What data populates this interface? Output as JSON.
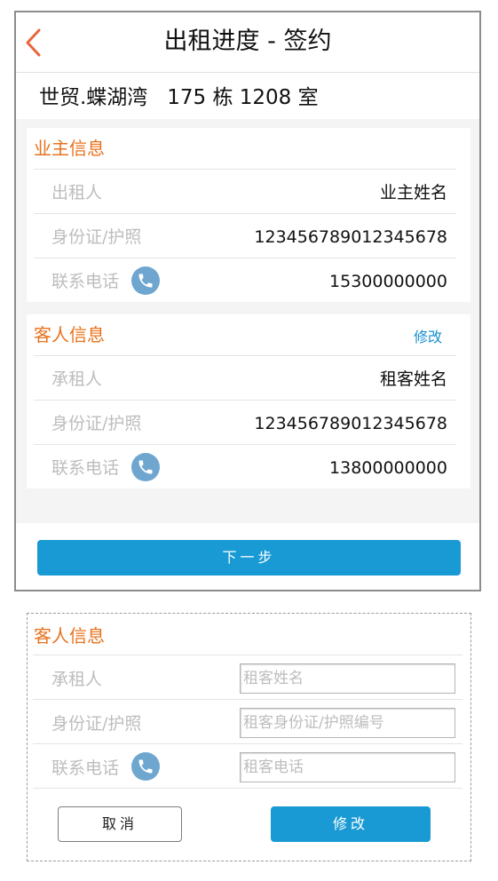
{
  "header": {
    "title": "出租进度 - 签约",
    "back_icon": "chevron-left-icon"
  },
  "property": {
    "address": "世贸.蝶湖湾   175 栋 1208 室"
  },
  "owner_section": {
    "title": "业主信息",
    "rows": [
      {
        "label": "出租人",
        "value": "业主姓名"
      },
      {
        "label": "身份证/护照",
        "value": "123456789012345678"
      },
      {
        "label": "联系电话",
        "value": "15300000000",
        "icon": "phone-icon"
      }
    ]
  },
  "guest_section": {
    "title": "客人信息",
    "edit_label": "修改",
    "rows": [
      {
        "label": "承租人",
        "value": "租客姓名"
      },
      {
        "label": "身份证/护照",
        "value": "123456789012345678"
      },
      {
        "label": "联系电话",
        "value": "13800000000",
        "icon": "phone-icon"
      }
    ]
  },
  "next_button": "下一步",
  "edit_dialog": {
    "title": "客人信息",
    "fields": [
      {
        "label": "承租人",
        "value": "",
        "placeholder": "租客姓名"
      },
      {
        "label": "身份证/护照",
        "value": "",
        "placeholder": "租客身份证/护照编号"
      },
      {
        "label": "联系电话",
        "value": "",
        "placeholder": "租客电话",
        "icon": "phone-icon"
      }
    ],
    "cancel_label": "取消",
    "confirm_label": "修改"
  },
  "colors": {
    "accent_orange": "#e8721d",
    "primary_blue": "#199ad4",
    "link_blue": "#1a8fd0",
    "phone_icon_blue": "#6fa6d0",
    "label_gray": "#bdbdbd"
  }
}
